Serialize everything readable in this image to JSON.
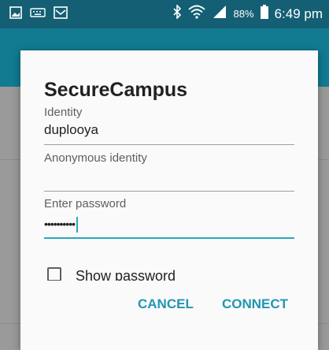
{
  "status_bar": {
    "battery": "88%",
    "time": "6:49 pm",
    "icons": [
      "gallery-icon",
      "keyboard-icon",
      "mail-icon",
      "bluetooth-icon",
      "wifi-icon",
      "signal-icon",
      "battery-icon"
    ]
  },
  "dialog": {
    "title": "SecureCampus",
    "identity": {
      "label": "Identity",
      "value": "duplooya"
    },
    "anonymous": {
      "label": "Anonymous identity",
      "value": ""
    },
    "password": {
      "label": "Enter password",
      "value": "••••••••••"
    },
    "show_password": {
      "label": "Show password",
      "checked": false
    },
    "cancel_label": "CANCEL",
    "connect_label": "CONNECT"
  },
  "colors": {
    "status_bar": "#145f73",
    "app_bar": "#127a91",
    "accent": "#2096b3"
  }
}
